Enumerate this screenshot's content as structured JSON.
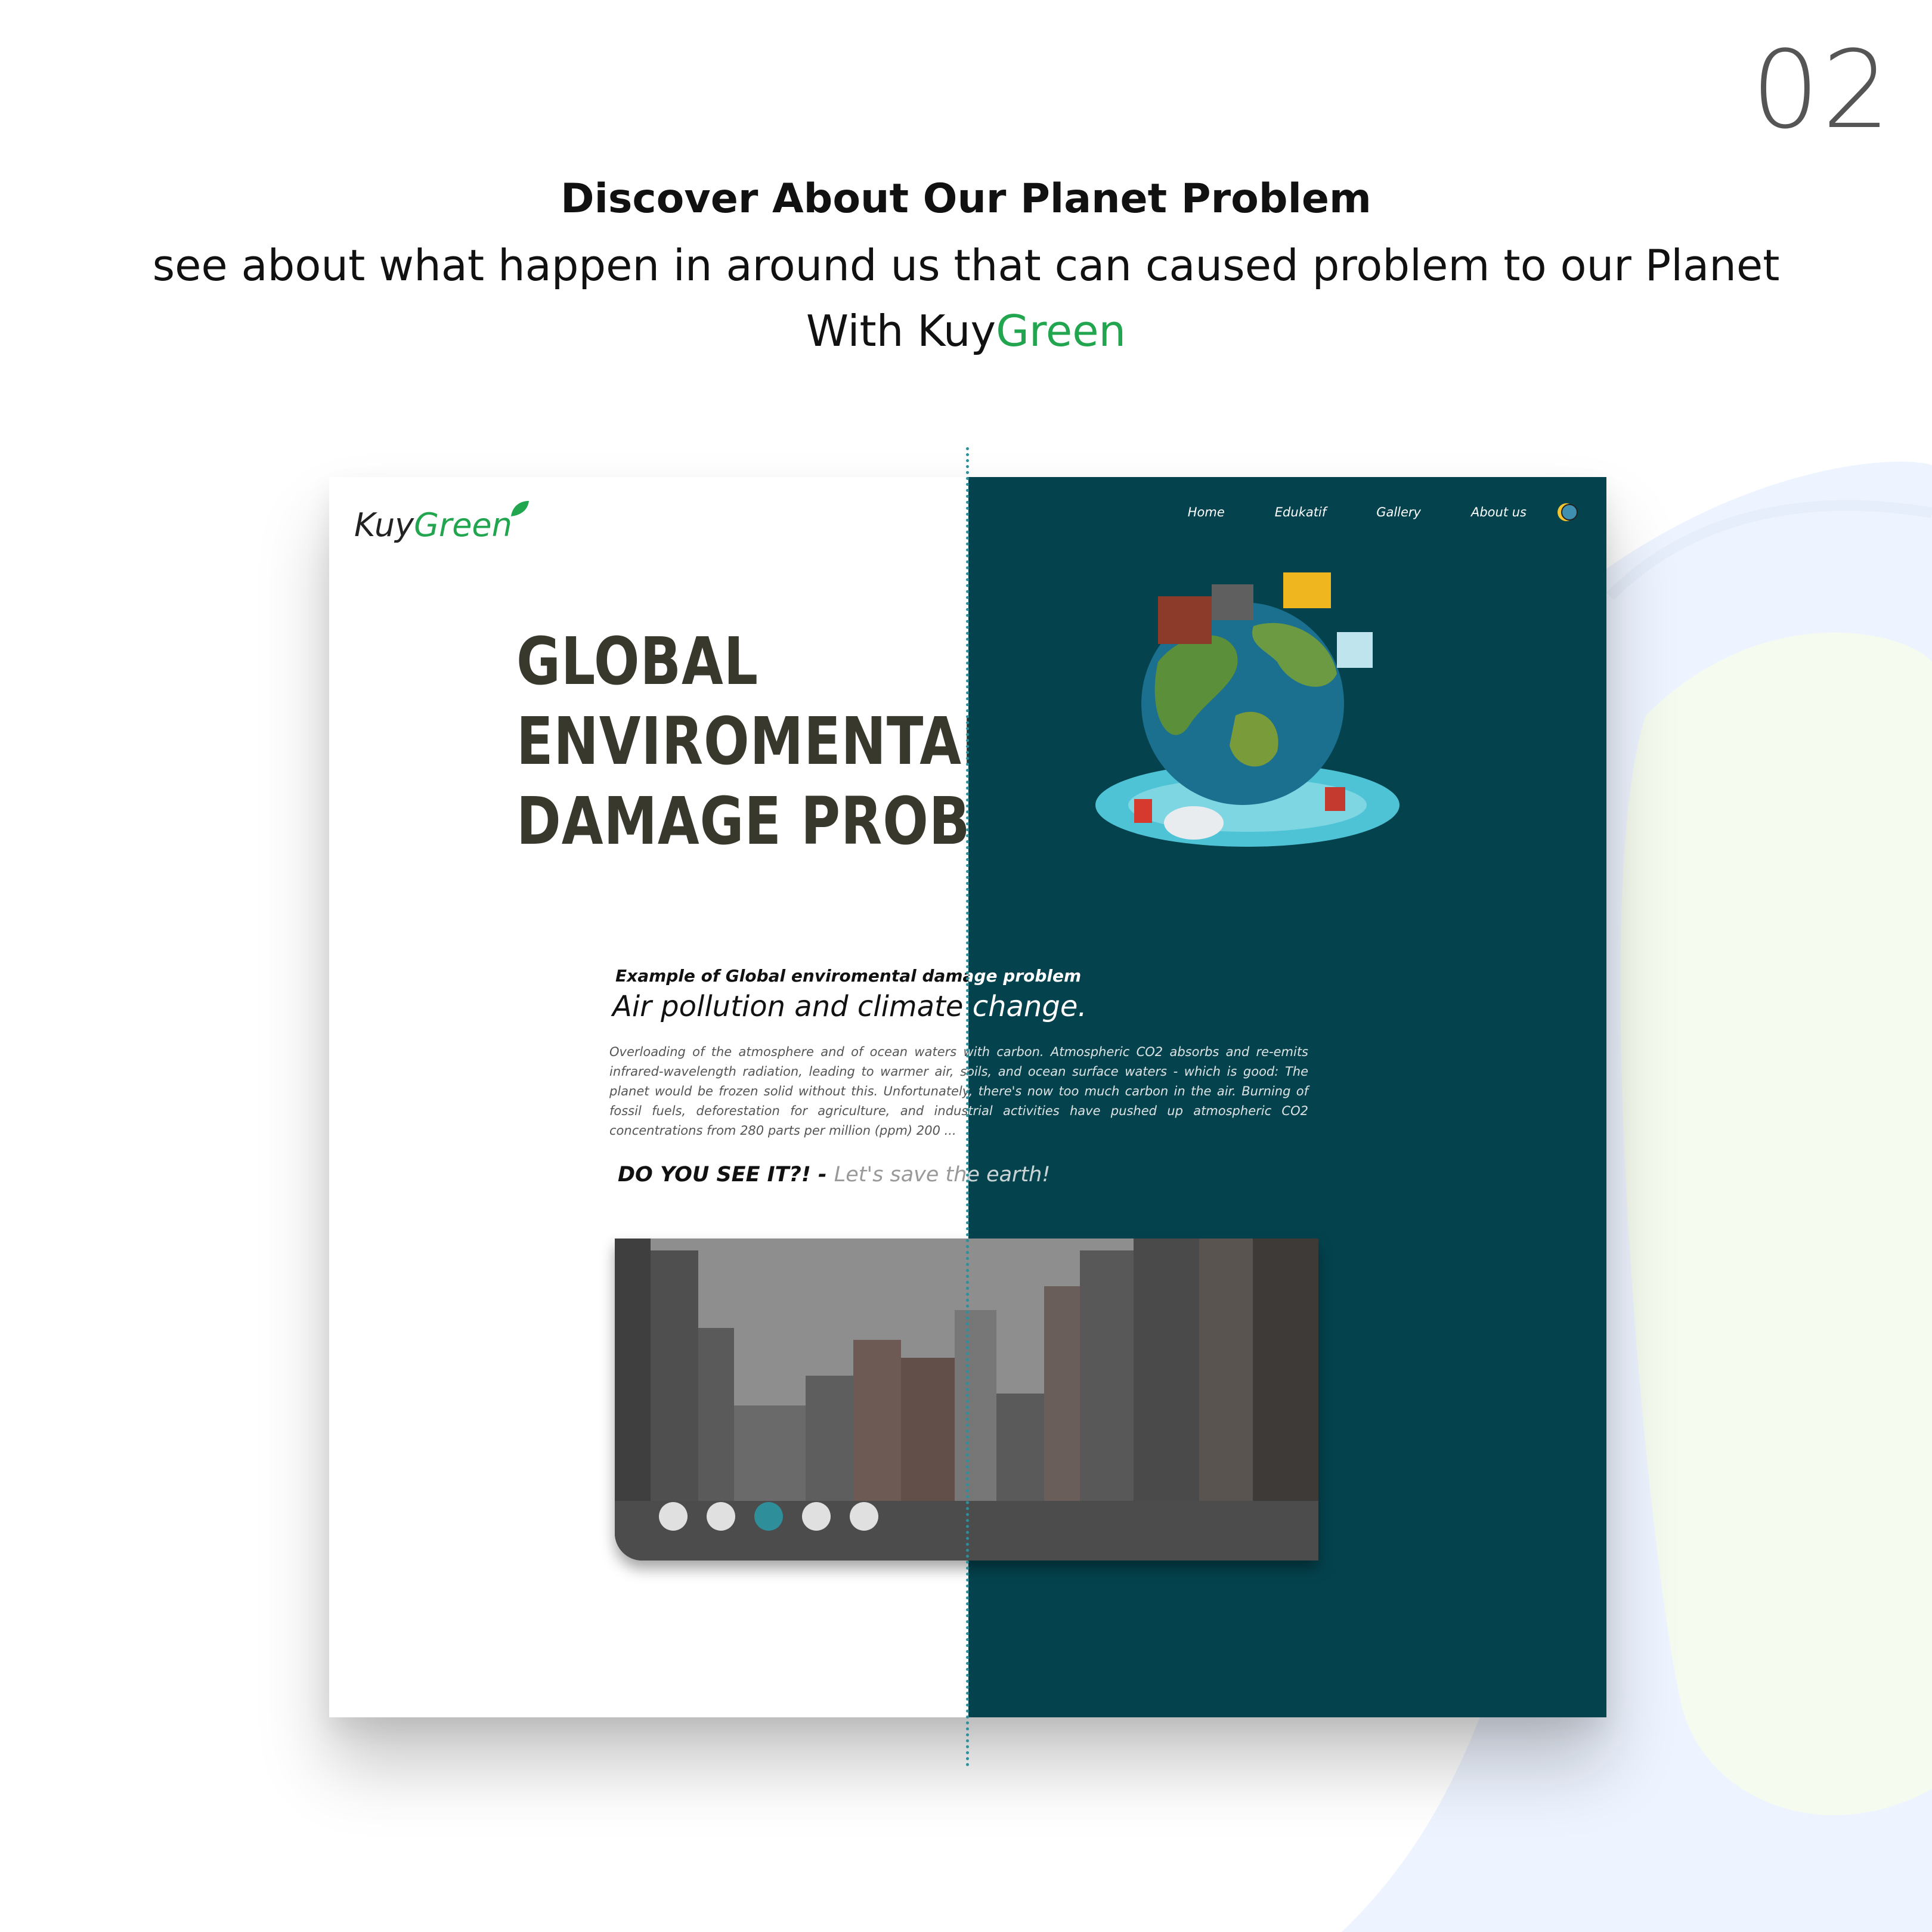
{
  "slide_number": "02",
  "header": {
    "title": "Discover About Our Planet Problem",
    "subtitle": "see about what happen in around us that can caused problem to our Planet",
    "brand_prefix": "With Kuy",
    "brand_green": "Green"
  },
  "site": {
    "logo_kuy": "Kuy",
    "logo_green": "Green",
    "nav": [
      "Home",
      "Edukatif",
      "Gallery",
      "About us"
    ],
    "hero_lines": [
      "GLOBAL",
      "ENVIROMENTAL",
      "DAMAGE PROBLEM"
    ],
    "kicker": "Example of Global enviromental damage problem",
    "heading": "Air pollution and climate change.",
    "body": "Overloading of the atmosphere and of ocean waters with carbon. Atmospheric CO2 absorbs and re-emits infrared-wavelength radiation, leading to warmer air, soils, and ocean surface waters - which is good: The planet would be frozen solid without this. Unfortunately, there's now too much carbon in the air. Burning of fossil fuels, deforestation for agriculture, and industrial activities have pushed up atmospheric CO2 concentrations from 280 parts per million (ppm) 200 ...",
    "cta_question": "DO YOU SEE IT?! - ",
    "cta_slogan": "Let's save the earth!",
    "carousel_active_index": 2,
    "carousel_count": 5
  },
  "colors": {
    "brand_green": "#22a54f",
    "dark_teal": "#04434e",
    "accent_dot": "#2e8f9b"
  }
}
